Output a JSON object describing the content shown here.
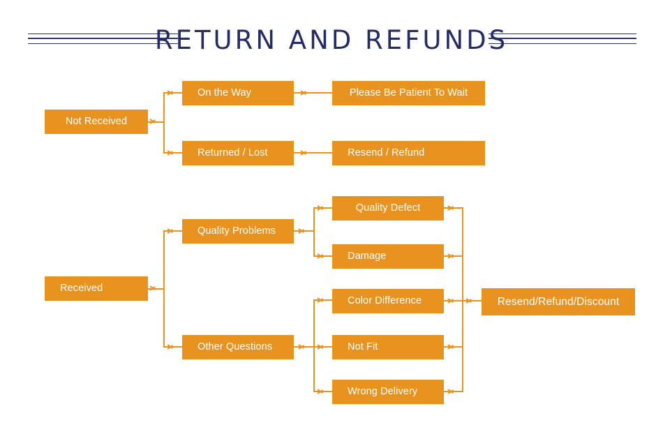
{
  "header": {
    "title": "RETURN AND REFUNDS",
    "rule_left_name": "decorative-rule-left",
    "rule_right_name": "decorative-rule-right"
  },
  "colors": {
    "box_fill": "#e8921f",
    "box_text": "#ffffff",
    "connector": "#e8921f",
    "title_text": "#252b63",
    "background": "#ffffff"
  },
  "flow": {
    "branch_not_received": {
      "root": "Not Received",
      "children": [
        {
          "label": "On the Way",
          "outcome": "Please Be Patient To Wait"
        },
        {
          "label": "Returned / Lost",
          "outcome": "Resend / Refund"
        }
      ]
    },
    "branch_received": {
      "root": "Received",
      "children": [
        {
          "label": "Quality Problems",
          "reasons": [
            "Quality Defect",
            "Damage"
          ]
        },
        {
          "label": "Other Questions",
          "reasons": [
            "Color Difference",
            "Not Fit",
            "Wrong Delivery"
          ]
        }
      ],
      "outcome": "Resend/Refund/Discount"
    }
  }
}
